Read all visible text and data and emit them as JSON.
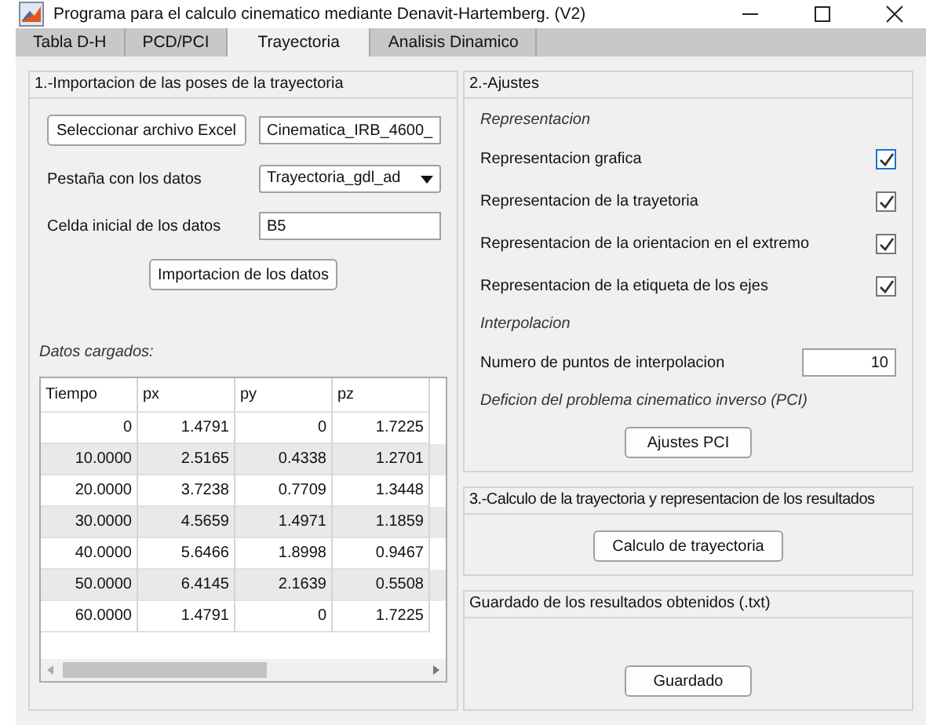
{
  "window": {
    "title": "Programa para el calculo cinematico mediante Denavit-Hartemberg. (V2)"
  },
  "tabs": [
    {
      "label": "Tabla D-H",
      "selected": false
    },
    {
      "label": "PCD/PCI",
      "selected": false
    },
    {
      "label": "Trayectoria",
      "selected": true
    },
    {
      "label": "Analisis Dinamico",
      "selected": false
    }
  ],
  "import_panel": {
    "title": "1.-Importacion de las poses de la trayectoria",
    "select_button": "Seleccionar archivo Excel",
    "file_value": "Cinematica_IRB_4600_",
    "sheet_label": "Pestaña con los datos",
    "sheet_value": "Trayectoria_gdl_ad",
    "cell_label": "Celda inicial de los datos",
    "cell_value": "B5",
    "import_button": "Importacion de los datos",
    "loaded_label": "Datos cargados:"
  },
  "table": {
    "columns": [
      "Tiempo",
      "px",
      "py",
      "pz"
    ],
    "rows": [
      [
        "0",
        "1.4791",
        "0",
        "1.7225"
      ],
      [
        "10.0000",
        "2.5165",
        "0.4338",
        "1.2701"
      ],
      [
        "20.0000",
        "3.7238",
        "0.7709",
        "1.3448"
      ],
      [
        "30.0000",
        "4.5659",
        "1.4971",
        "1.1859"
      ],
      [
        "40.0000",
        "5.6466",
        "1.8998",
        "0.9467"
      ],
      [
        "50.0000",
        "6.4145",
        "2.1639",
        "0.5508"
      ],
      [
        "60.0000",
        "1.4791",
        "0",
        "1.7225"
      ]
    ]
  },
  "settings_panel": {
    "title": "2.-Ajustes",
    "representation_heading": "Representacion",
    "options": [
      {
        "label": "Representacion grafica",
        "checked": true
      },
      {
        "label": "Representacion de la trayetoria",
        "checked": true
      },
      {
        "label": "Representacion de la orientacion en el extremo",
        "checked": true
      },
      {
        "label": "Representacion de la etiqueta de los ejes",
        "checked": true
      }
    ],
    "interpolation_heading": "Interpolacion",
    "points_label": "Numero de puntos de interpolacion",
    "points_value": "10",
    "pci_heading": "Deficion del problema cinematico inverso (PCI)",
    "pci_button": "Ajustes PCI"
  },
  "calc_panel": {
    "title": "3.-Calculo de la trayectoria y representacion de los resultados",
    "button": "Calculo de trayectoria"
  },
  "save_panel": {
    "title": "Guardado de los resultados obtenidos (.txt)",
    "button": "Guardado"
  }
}
